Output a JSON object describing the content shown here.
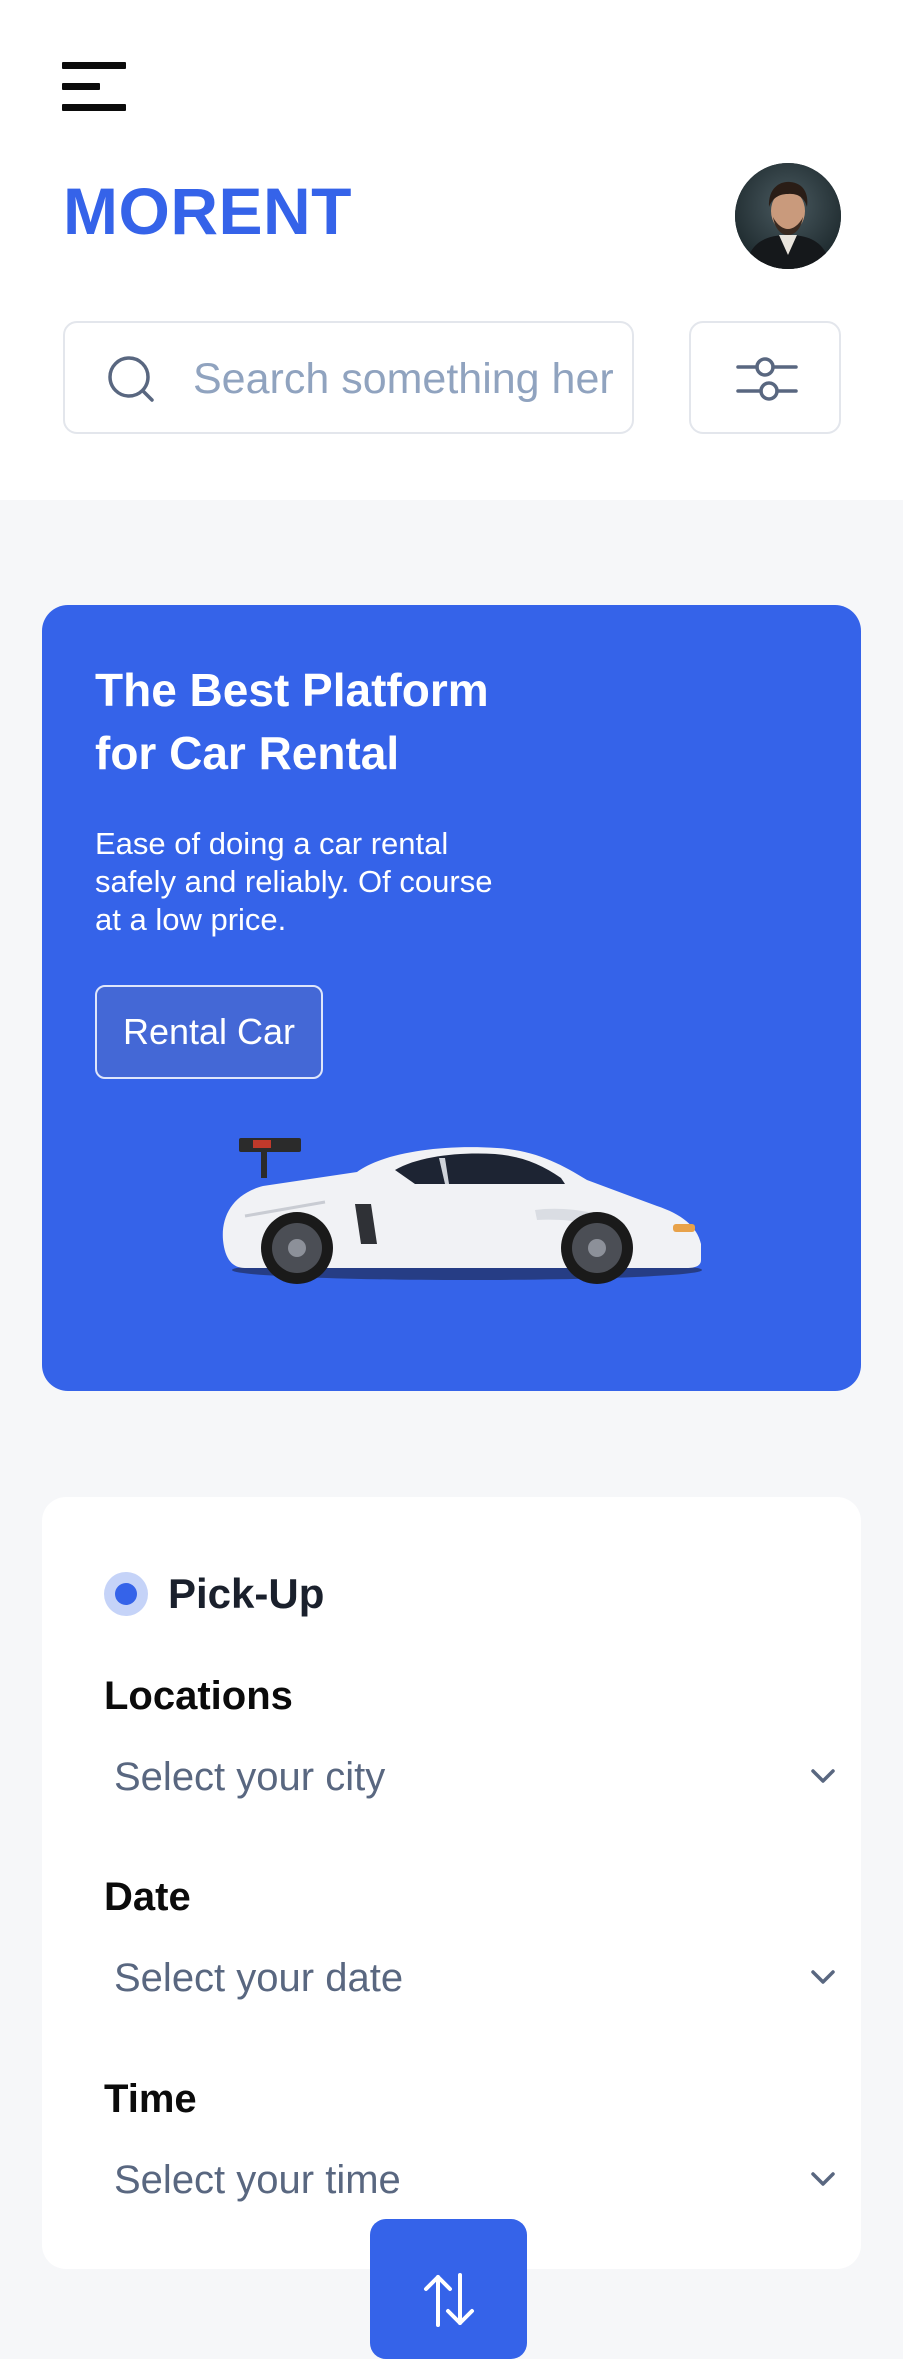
{
  "header": {
    "brand": "MORENT",
    "menu_icon": "hamburger-menu-icon",
    "avatar_icon": "user-avatar"
  },
  "search": {
    "placeholder": "Search something here",
    "icon": "search-icon"
  },
  "filter": {
    "icon": "filter-sliders-icon"
  },
  "hero": {
    "title_line1": "The Best Platform",
    "title_line2": "for Car Rental",
    "subtitle_line1": "Ease of doing a car rental",
    "subtitle_line2": "safely and reliably. Of course",
    "subtitle_line3": "at a low price.",
    "button_label": "Rental Car",
    "background": "#3563E9"
  },
  "pickup": {
    "title": "Pick-Up",
    "selected": true,
    "fields": [
      {
        "label": "Locations",
        "placeholder": "Select your city"
      },
      {
        "label": "Date",
        "placeholder": "Select your date"
      },
      {
        "label": "Time",
        "placeholder": "Select your time"
      }
    ]
  },
  "swap": {
    "icon": "swap-arrows-icon"
  },
  "colors": {
    "accent": "#3563E9",
    "page_background": "#F6F7F9",
    "muted_text": "#596780",
    "placeholder_text": "#90A3BF"
  }
}
